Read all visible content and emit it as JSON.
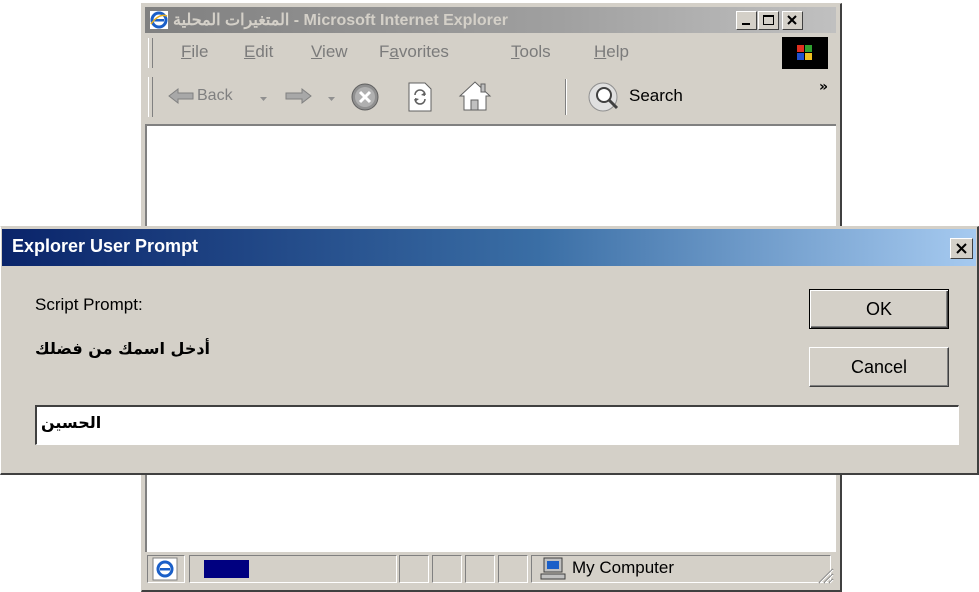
{
  "ie_window": {
    "title": "المتغيرات المحلية - Microsoft Internet Explorer",
    "menu": [
      {
        "label": "File",
        "accel": "F",
        "rest": "ile"
      },
      {
        "label": "Edit",
        "accel": "E",
        "rest": "dit"
      },
      {
        "label": "View",
        "accel": "V",
        "rest": "iew"
      },
      {
        "label": "Favorites",
        "accel": "a",
        "pre": "F",
        "rest": "vorites"
      },
      {
        "label": "Tools",
        "accel": "T",
        "rest": "ools"
      },
      {
        "label": "Help",
        "accel": "H",
        "rest": "elp"
      }
    ],
    "toolbar": {
      "back_label": "Back",
      "search_label": "Search",
      "more_glyph": "»"
    },
    "status": {
      "zone_text": "My Computer",
      "progress_fraction": 0.25
    }
  },
  "dialog": {
    "title": "Explorer User Prompt",
    "prompt_label": "Script Prompt:",
    "message": "أدخل اسمك من فضلك",
    "input_value": "الحسين",
    "ok_label": "OK",
    "cancel_label": "Cancel"
  },
  "colors": {
    "dialog_title_start": "#0a246a",
    "dialog_title_end": "#a6caf0",
    "inactive_title": "#808080",
    "face": "#d4d0c8",
    "progress": "#000080"
  },
  "icons": [
    "ie-icon",
    "minimize-icon",
    "maximize-icon",
    "close-icon",
    "windows-logo-icon",
    "back-arrow-icon",
    "forward-arrow-icon",
    "dropdown-arrow-icon",
    "stop-icon",
    "refresh-icon",
    "home-icon",
    "search-icon",
    "computer-icon",
    "resize-grip-icon"
  ]
}
